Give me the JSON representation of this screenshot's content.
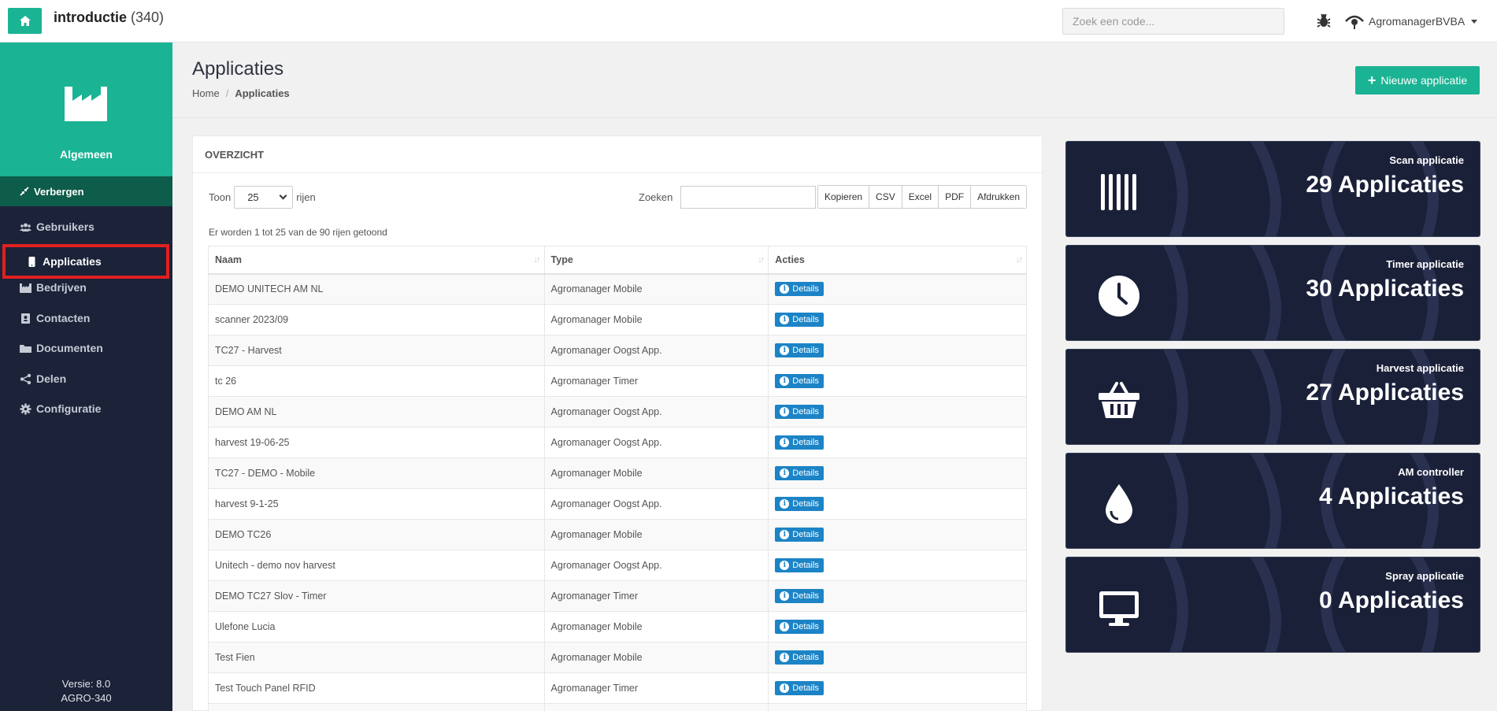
{
  "topbar": {
    "app_name": "introductie",
    "app_count": "(340)",
    "search_placeholder": "Zoek een code...",
    "account_name": "AgromanagerBVBA"
  },
  "sidebar": {
    "header_label": "Algemeen",
    "hide_label": "Verbergen",
    "items": [
      {
        "label": "Gebruikers",
        "icon": "users-icon"
      },
      {
        "label": "Applicaties",
        "icon": "mobile-icon",
        "active": true
      },
      {
        "label": "Bedrijven",
        "icon": "factory-icon"
      },
      {
        "label": "Contacten",
        "icon": "address-book-icon"
      },
      {
        "label": "Documenten",
        "icon": "folder-icon"
      },
      {
        "label": "Delen",
        "icon": "share-icon"
      },
      {
        "label": "Configuratie",
        "icon": "gear-icon"
      }
    ],
    "version": "Versie: 8.0",
    "build": "AGRO-340"
  },
  "page": {
    "title": "Applicaties",
    "breadcrumb_home": "Home",
    "breadcrumb_current": "Applicaties",
    "new_button": "Nieuwe applicatie"
  },
  "panel": {
    "title": "OVERZICHT",
    "show_label": "Toon",
    "show_value": "25",
    "rows_label": "rijen",
    "search_label": "Zoeken",
    "export_buttons": [
      "Kopieren",
      "CSV",
      "Excel",
      "PDF",
      "Afdrukken"
    ],
    "info": "Er worden 1 tot 25 van de 90 rijen getoond",
    "columns": [
      "Naam",
      "Type",
      "Acties"
    ],
    "details_label": "Details",
    "rows": [
      {
        "name": "DEMO UNITECH AM NL",
        "type": "Agromanager Mobile"
      },
      {
        "name": "scanner 2023/09",
        "type": "Agromanager Mobile"
      },
      {
        "name": "TC27 - Harvest",
        "type": "Agromanager Oogst App."
      },
      {
        "name": "tc 26",
        "type": "Agromanager Timer"
      },
      {
        "name": "DEMO AM NL",
        "type": "Agromanager Oogst App."
      },
      {
        "name": "harvest 19-06-25",
        "type": "Agromanager Oogst App."
      },
      {
        "name": "TC27 - DEMO - Mobile",
        "type": "Agromanager Mobile"
      },
      {
        "name": "harvest 9-1-25",
        "type": "Agromanager Oogst App."
      },
      {
        "name": "DEMO TC26",
        "type": "Agromanager Mobile"
      },
      {
        "name": "Unitech - demo nov harvest",
        "type": "Agromanager Oogst App."
      },
      {
        "name": "DEMO TC27 Slov - Timer",
        "type": "Agromanager Timer"
      },
      {
        "name": "Ulefone Lucia",
        "type": "Agromanager Mobile"
      },
      {
        "name": "Test Fien",
        "type": "Agromanager Mobile"
      },
      {
        "name": "Test Touch Panel RFID",
        "type": "Agromanager Timer"
      },
      {
        "name": "",
        "type": ""
      }
    ]
  },
  "cards": [
    {
      "label": "Scan applicatie",
      "value": "29 Applicaties",
      "icon": "barcode-icon"
    },
    {
      "label": "Timer applicatie",
      "value": "30 Applicaties",
      "icon": "clock-icon"
    },
    {
      "label": "Harvest applicatie",
      "value": "27 Applicaties",
      "icon": "basket-icon"
    },
    {
      "label": "AM controller",
      "value": "4 Applicaties",
      "icon": "droplet-icon"
    },
    {
      "label": "Spray applicatie",
      "value": "0 Applicaties",
      "icon": "monitor-icon"
    }
  ],
  "colors": {
    "brand": "#1ab394",
    "sidebar_bg": "#1c2238",
    "card_bg": "#1a2038",
    "details_button": "#1c84c6",
    "active_outline": "#e02020"
  }
}
